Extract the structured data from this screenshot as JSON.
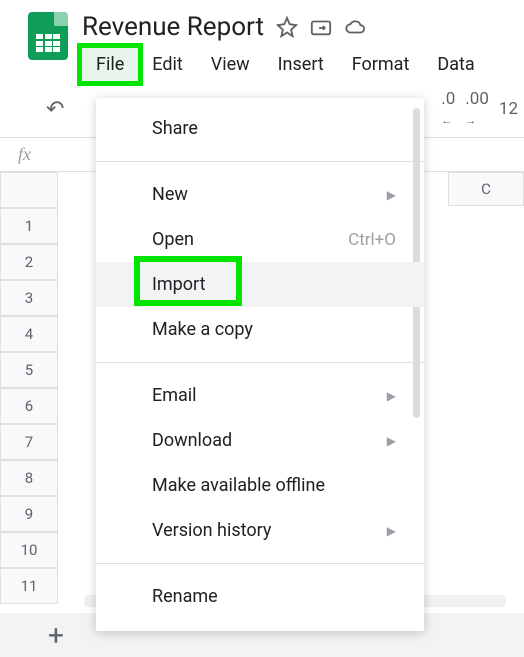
{
  "doc": {
    "title": "Revenue Report"
  },
  "menubar": {
    "file": "File",
    "edit": "Edit",
    "view": "View",
    "insert": "Insert",
    "format": "Format",
    "data": "Data"
  },
  "toolbar": {
    "dec_less": ".0",
    "dec_more": ".00",
    "font_size": "12"
  },
  "fx": {
    "label": "fx"
  },
  "columns": {
    "c": "C"
  },
  "rows": [
    "1",
    "2",
    "3",
    "4",
    "5",
    "6",
    "7",
    "8",
    "9",
    "10",
    "11"
  ],
  "dropdown": {
    "share": "Share",
    "new": "New",
    "open": "Open",
    "open_shortcut": "Ctrl+O",
    "import": "Import",
    "make_copy": "Make a copy",
    "email": "Email",
    "download": "Download",
    "offline": "Make available offline",
    "version_history": "Version history",
    "rename": "Rename"
  },
  "footer": {
    "add": "+"
  }
}
